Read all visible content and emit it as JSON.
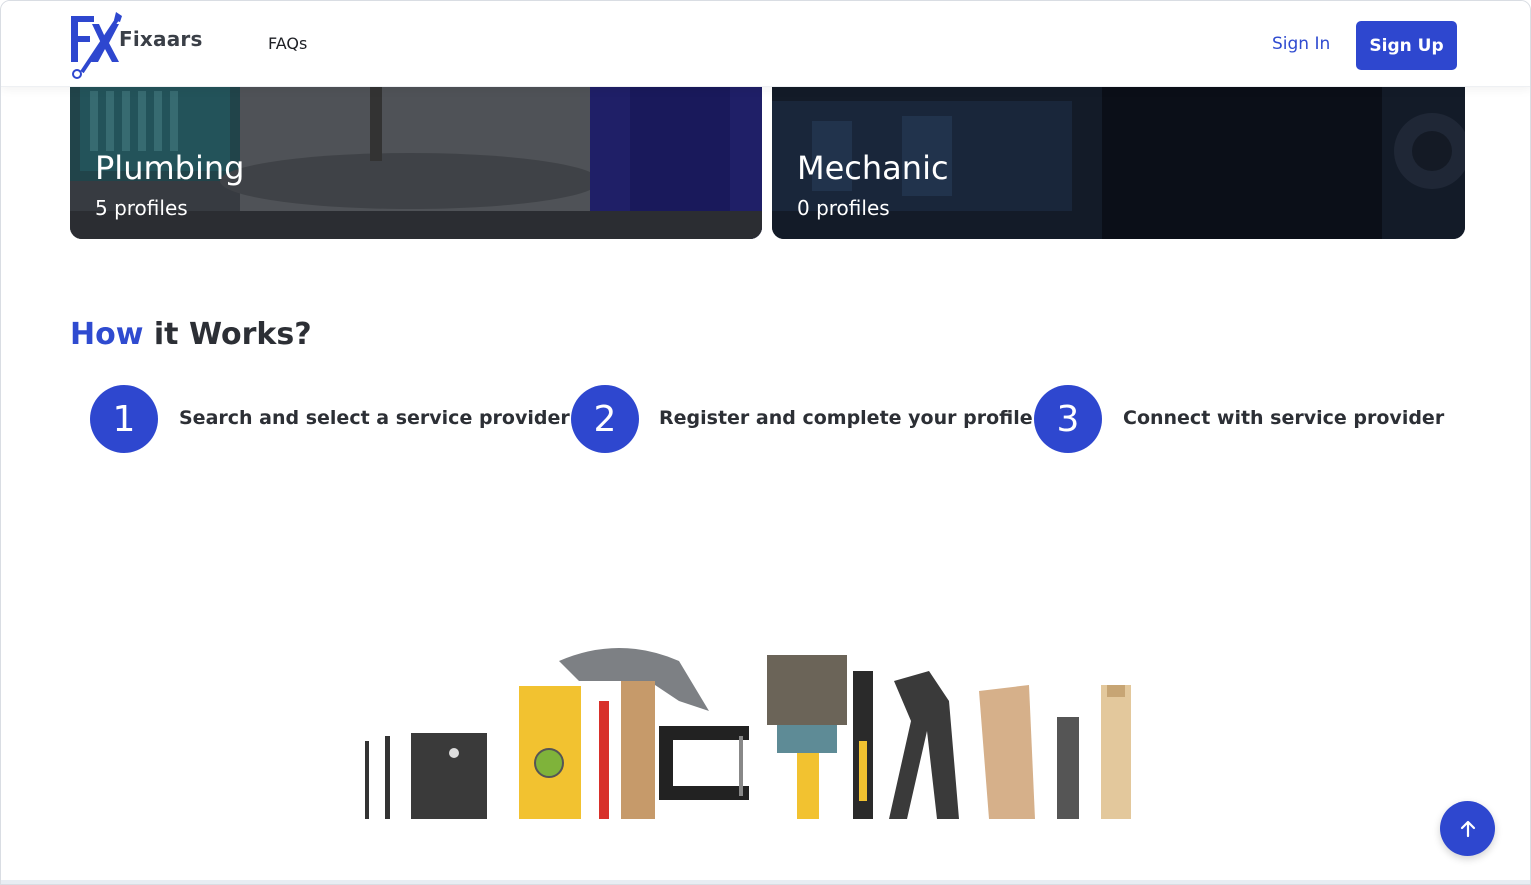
{
  "header": {
    "brand": "Fixaars",
    "logo_letters": "FX",
    "nav": {
      "faqs": "FAQs"
    },
    "sign_in": "Sign In",
    "sign_up": "Sign Up"
  },
  "categories": [
    {
      "title": "Plumbing",
      "count": "5 profiles"
    },
    {
      "title": "Mechanic",
      "count": "0 profiles"
    }
  ],
  "how_it_works": {
    "title_accent": "How",
    "title_rest": "it Works?",
    "steps": [
      {
        "number": "1",
        "text": "Search and select a service provider"
      },
      {
        "number": "2",
        "text": "Register and complete your profile"
      },
      {
        "number": "3",
        "text": "Connect with service provider"
      }
    ]
  },
  "icons": {
    "scroll_top": "arrow-up-icon",
    "logo": "wrench-logo-icon"
  },
  "colors": {
    "primary": "#2e47cf",
    "text_dark": "#2c2f35"
  }
}
